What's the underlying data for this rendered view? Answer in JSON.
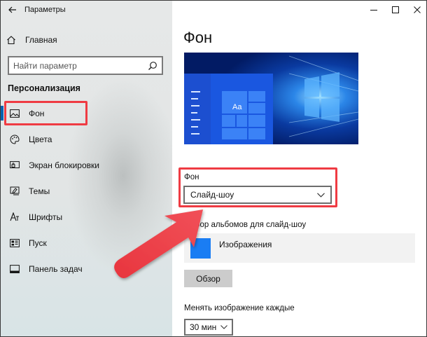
{
  "window": {
    "title": "Параметры",
    "controls": [
      "minimize",
      "maximize",
      "close"
    ]
  },
  "sidebar": {
    "home_label": "Главная",
    "search_placeholder": "Найти параметр",
    "section_title": "Персонализация",
    "items": [
      {
        "label": "Фон",
        "icon": "image-icon",
        "active": true
      },
      {
        "label": "Цвета",
        "icon": "palette-icon",
        "active": false
      },
      {
        "label": "Экран блокировки",
        "icon": "lock-screen-icon",
        "active": false
      },
      {
        "label": "Темы",
        "icon": "brush-icon",
        "active": false
      },
      {
        "label": "Шрифты",
        "icon": "font-icon",
        "active": false
      },
      {
        "label": "Пуск",
        "icon": "start-icon",
        "active": false
      },
      {
        "label": "Панель задач",
        "icon": "taskbar-icon",
        "active": false
      }
    ]
  },
  "main": {
    "title": "Фон",
    "preview": {
      "tile_text": "Aa"
    },
    "background_label": "Фон",
    "background_value": "Слайд-шоу",
    "albums_label": "Выбор альбомов для слайд-шоу",
    "album_name": "Изображения",
    "browse_label": "Обзор",
    "interval_label": "Менять изображение каждые",
    "interval_value": "30 мин"
  },
  "colors": {
    "accent": "#0063b1",
    "highlight": "#ef3b43",
    "tile_blue": "#1a7df3",
    "preview_bg": "#021b64"
  }
}
